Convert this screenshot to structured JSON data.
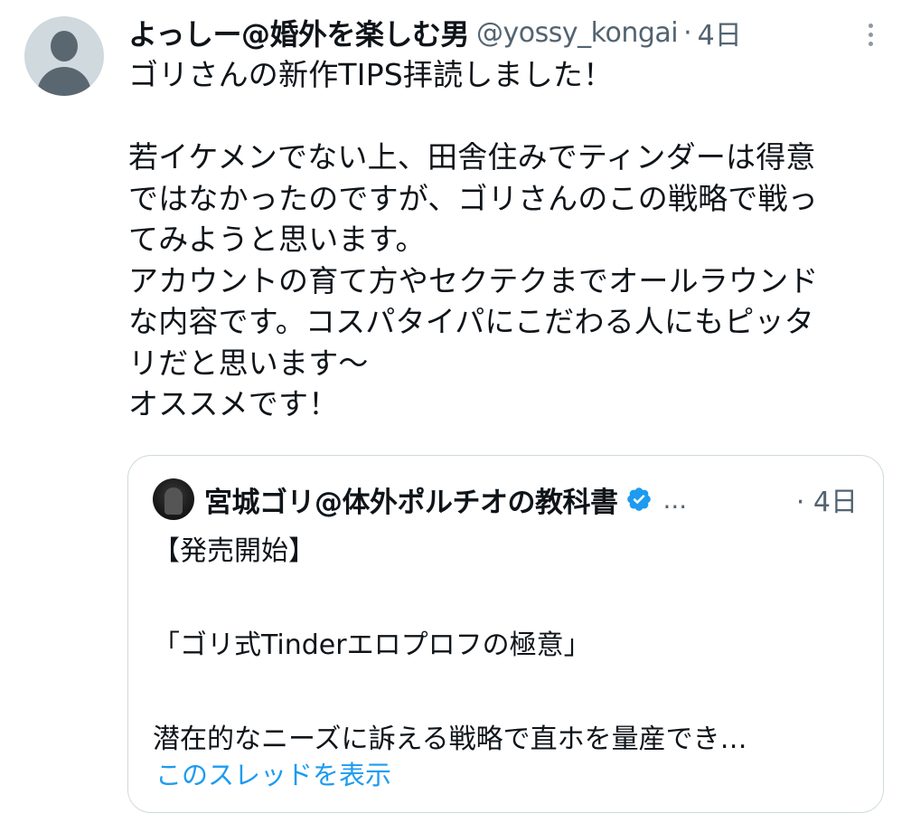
{
  "tweet": {
    "author": {
      "display_name": "よっしー@婚外を楽しむ男",
      "handle": "@yossy_kongai",
      "separator": "·",
      "time": "4日"
    },
    "text": "ゴリさんの新作TIPS拝読しました！\n\n若イケメンでない上、田舎住みでティンダーは得意\nではなかったのですが、ゴリさんのこの戦略で戦っ\nてみようと思います。\nアカウントの育て方やセクテクまでオールラウンド\nな内容です。コスパタイパにこだわる人にもピッタ\nリだと思います〜\nオススメです！",
    "more_icon": "more-vertical-icon"
  },
  "quoted_tweet": {
    "author": {
      "display_name": "宮城ゴリ@体外ポルチオの教科書",
      "verified_icon": "verified-badge-icon",
      "ellipsis": "...",
      "time": "· 4日"
    },
    "text": "【発売開始】\n\n「ゴリ式Tinderエロプロフの極意」\n\n潜在的なニーズに訴える戦略で直ホを量産でき…",
    "show_thread_link": "このスレッドを表示"
  },
  "colors": {
    "text_primary": "#0f1419",
    "text_secondary": "#536471",
    "link": "#1d9bf0",
    "border": "#cfd9de",
    "verified": "#1d9bf0"
  }
}
